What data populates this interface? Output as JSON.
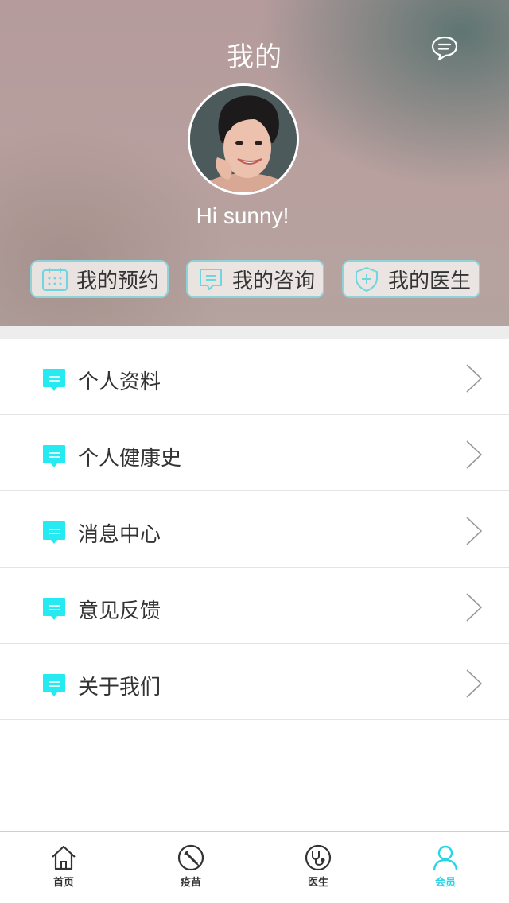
{
  "header": {
    "title": "我的",
    "message_icon": "chat-bubble-icon",
    "greeting": "Hi sunny!"
  },
  "quick_actions": [
    {
      "label": "我的预约",
      "icon": "calendar-icon"
    },
    {
      "label": "我的咨询",
      "icon": "chat-icon"
    },
    {
      "label": "我的医生",
      "icon": "shield-plus-icon"
    }
  ],
  "menu": [
    {
      "label": "个人资料",
      "icon": "chat-bubble-icon"
    },
    {
      "label": "个人健康史",
      "icon": "chat-bubble-icon"
    },
    {
      "label": "消息中心",
      "icon": "chat-bubble-icon"
    },
    {
      "label": "意见反馈",
      "icon": "chat-bubble-icon"
    },
    {
      "label": "关于我们",
      "icon": "chat-bubble-icon"
    }
  ],
  "tabbar": {
    "items": [
      {
        "label": "首页",
        "icon": "home-icon",
        "active": false
      },
      {
        "label": "疫苗",
        "icon": "syringe-icon",
        "active": false
      },
      {
        "label": "医生",
        "icon": "stethoscope-icon",
        "active": false
      },
      {
        "label": "会员",
        "icon": "user-icon",
        "active": true
      }
    ]
  },
  "colors": {
    "accent": "#26d5e6",
    "text": "#333333",
    "header_bg": "#b59b9c"
  }
}
